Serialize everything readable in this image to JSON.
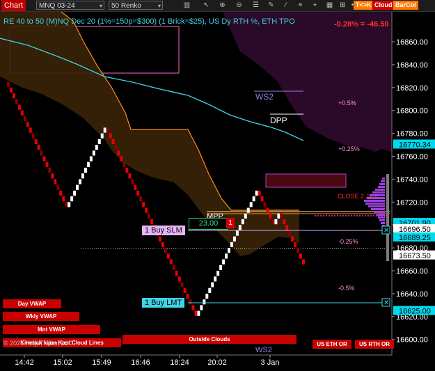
{
  "toolbar": {
    "title": "Chart",
    "instrument": "MNQ 03-24",
    "bar_type": "50 Renko",
    "buttons": [
      {
        "label": "T<>K",
        "color": "#ff7a00"
      },
      {
        "label": "Cloud",
        "color": "#d40000"
      },
      {
        "label": "BarCol",
        "color": "#ff7a00"
      }
    ],
    "icons": [
      "bars-icon",
      "cursor-icon",
      "zoom-in-icon",
      "zoom-out-icon",
      "properties-icon",
      "pen-icon",
      "draw-icon",
      "list-icon",
      "pin-icon",
      "grid-icon",
      "ruler-icon",
      "dot-icon"
    ]
  },
  "series_label": "RE 40 to 50 (M)NQ Dec 20 (1%=150p=$300) (1 Brick=$25), US Dy RTH %, ETH TPO",
  "pnl_label": "-0.28% = -46.50",
  "price_axis": {
    "ticks": [
      "16860.00",
      "16840.00",
      "16820.00",
      "16800.00",
      "16780.00",
      "16760.00",
      "16740.00",
      "16720.00",
      "16700.00",
      "16680.00",
      "16660.00",
      "16640.00",
      "16620.00",
      "16600.00"
    ],
    "markers": [
      {
        "label": "16770.34",
        "bg": "#00d9f0",
        "fg": "#000"
      },
      {
        "label": "16701.90",
        "bg": "#00d9f0",
        "fg": "#000"
      },
      {
        "label": "16696.50",
        "bg": "#fff",
        "fg": "#000"
      },
      {
        "label": "16689.25",
        "bg": "#00d9f0",
        "fg": "#000"
      },
      {
        "label": "16673.50",
        "bg": "#fff",
        "fg": "#000"
      },
      {
        "label": "16625.00",
        "bg": "#00d9f0",
        "fg": "#000"
      }
    ]
  },
  "time_axis": [
    "14:42",
    "15:02",
    "15:49",
    "16:46",
    "18:24",
    "20:02",
    "3 Jan"
  ],
  "levels": {
    "ws2": "WS2",
    "dpp": "DPP",
    "mpp": "MPP",
    "ws2_bottom": "WS2",
    "pct_labels": [
      "+0.5%",
      "+0.25%",
      "-0.25%",
      "-0.5%"
    ],
    "close_label": "CLOSE 2 JAN"
  },
  "orders": {
    "slm_label": "1 Buy SLM",
    "lmt_label": "1 Buy LMT",
    "position_qty": "23.00",
    "position_count": "1"
  },
  "indicator_buttons": {
    "day_vwap": "Day VWAP",
    "wkly_vwap": "Wkly VWAP",
    "mnt_vwap": "Mnt VWAP",
    "kijun": "Kinetick kijun Kast Cloud Lines",
    "outside_clouds": "Outside Clouds",
    "us_eth_or": "US ETH OR",
    "us_rth_or": "US RTH OR"
  },
  "copyright": "© 2024 NinjaTrader, LLC",
  "chart_data": {
    "type": "renko",
    "brick_size": 5,
    "ylim": [
      16590,
      16870
    ],
    "x_tick_labels": [
      "14:42",
      "15:02",
      "15:49",
      "16:46",
      "18:24",
      "20:02",
      "3 Jan"
    ],
    "bricks": [
      {
        "o": 16825,
        "c": 16820
      },
      {
        "o": 16820,
        "c": 16815
      },
      {
        "o": 16815,
        "c": 16810
      },
      {
        "o": 16810,
        "c": 16805
      },
      {
        "o": 16805,
        "c": 16800
      },
      {
        "o": 16800,
        "c": 16795
      },
      {
        "o": 16795,
        "c": 16790
      },
      {
        "o": 16790,
        "c": 16785
      },
      {
        "o": 16785,
        "c": 16780
      },
      {
        "o": 16780,
        "c": 16775
      },
      {
        "o": 16775,
        "c": 16770
      },
      {
        "o": 16770,
        "c": 16765
      },
      {
        "o": 16765,
        "c": 16760
      },
      {
        "o": 16760,
        "c": 16755
      },
      {
        "o": 16755,
        "c": 16750
      },
      {
        "o": 16750,
        "c": 16745
      },
      {
        "o": 16745,
        "c": 16740
      },
      {
        "o": 16740,
        "c": 16735
      },
      {
        "o": 16735,
        "c": 16730
      },
      {
        "o": 16730,
        "c": 16725
      },
      {
        "o": 16725,
        "c": 16720
      },
      {
        "o": 16720,
        "c": 16715
      },
      {
        "o": 16715,
        "c": 16720
      },
      {
        "o": 16720,
        "c": 16725
      },
      {
        "o": 16725,
        "c": 16730
      },
      {
        "o": 16730,
        "c": 16735
      },
      {
        "o": 16735,
        "c": 16740
      },
      {
        "o": 16740,
        "c": 16745
      },
      {
        "o": 16745,
        "c": 16750
      },
      {
        "o": 16750,
        "c": 16755
      },
      {
        "o": 16755,
        "c": 16760
      },
      {
        "o": 16760,
        "c": 16765
      },
      {
        "o": 16765,
        "c": 16770
      },
      {
        "o": 16770,
        "c": 16775
      },
      {
        "o": 16775,
        "c": 16780
      },
      {
        "o": 16780,
        "c": 16785
      },
      {
        "o": 16785,
        "c": 16780
      },
      {
        "o": 16780,
        "c": 16775
      },
      {
        "o": 16775,
        "c": 16770
      },
      {
        "o": 16770,
        "c": 16765
      },
      {
        "o": 16765,
        "c": 16760
      },
      {
        "o": 16760,
        "c": 16755
      },
      {
        "o": 16755,
        "c": 16750
      },
      {
        "o": 16750,
        "c": 16745
      },
      {
        "o": 16745,
        "c": 16740
      },
      {
        "o": 16740,
        "c": 16735
      },
      {
        "o": 16735,
        "c": 16730
      },
      {
        "o": 16730,
        "c": 16725
      },
      {
        "o": 16725,
        "c": 16720
      },
      {
        "o": 16720,
        "c": 16715
      },
      {
        "o": 16715,
        "c": 16710
      },
      {
        "o": 16710,
        "c": 16705
      },
      {
        "o": 16705,
        "c": 16700
      },
      {
        "o": 16700,
        "c": 16695
      },
      {
        "o": 16695,
        "c": 16690
      },
      {
        "o": 16690,
        "c": 16685
      },
      {
        "o": 16685,
        "c": 16680
      },
      {
        "o": 16680,
        "c": 16675
      },
      {
        "o": 16675,
        "c": 16670
      },
      {
        "o": 16670,
        "c": 16665
      },
      {
        "o": 16665,
        "c": 16660
      },
      {
        "o": 16660,
        "c": 16655
      },
      {
        "o": 16655,
        "c": 16650
      },
      {
        "o": 16650,
        "c": 16645
      },
      {
        "o": 16645,
        "c": 16640
      },
      {
        "o": 16640,
        "c": 16635
      },
      {
        "o": 16635,
        "c": 16630
      },
      {
        "o": 16630,
        "c": 16625
      },
      {
        "o": 16625,
        "c": 16620
      },
      {
        "o": 16620,
        "c": 16625
      },
      {
        "o": 16625,
        "c": 16630
      },
      {
        "o": 16630,
        "c": 16635
      },
      {
        "o": 16635,
        "c": 16640
      },
      {
        "o": 16640,
        "c": 16645
      },
      {
        "o": 16645,
        "c": 16650
      },
      {
        "o": 16650,
        "c": 16655
      },
      {
        "o": 16655,
        "c": 16660
      },
      {
        "o": 16660,
        "c": 16665
      },
      {
        "o": 16665,
        "c": 16670
      },
      {
        "o": 16670,
        "c": 16675
      },
      {
        "o": 16675,
        "c": 16680
      },
      {
        "o": 16680,
        "c": 16685
      },
      {
        "o": 16685,
        "c": 16690
      },
      {
        "o": 16690,
        "c": 16695
      },
      {
        "o": 16695,
        "c": 16700
      },
      {
        "o": 16700,
        "c": 16705
      },
      {
        "o": 16705,
        "c": 16710
      },
      {
        "o": 16710,
        "c": 16715
      },
      {
        "o": 16715,
        "c": 16720
      },
      {
        "o": 16720,
        "c": 16725
      },
      {
        "o": 16725,
        "c": 16730
      },
      {
        "o": 16730,
        "c": 16725
      },
      {
        "o": 16725,
        "c": 16720
      },
      {
        "o": 16720,
        "c": 16715
      },
      {
        "o": 16715,
        "c": 16710
      },
      {
        "o": 16710,
        "c": 16705
      },
      {
        "o": 16705,
        "c": 16700
      },
      {
        "o": 16700,
        "c": 16705
      },
      {
        "o": 16705,
        "c": 16710
      },
      {
        "o": 16710,
        "c": 16705
      },
      {
        "o": 16705,
        "c": 16700
      },
      {
        "o": 16700,
        "c": 16695
      },
      {
        "o": 16695,
        "c": 16690
      },
      {
        "o": 16690,
        "c": 16685
      },
      {
        "o": 16685,
        "c": 16680
      },
      {
        "o": 16680,
        "c": 16675
      },
      {
        "o": 16675,
        "c": 16670
      },
      {
        "o": 16670,
        "c": 16665
      }
    ],
    "levels": [
      {
        "name": "WS2",
        "price": 16815
      },
      {
        "name": "DPP",
        "price": 16795
      },
      {
        "name": "MPP",
        "price": 16702
      },
      {
        "name": "1 Buy SLM",
        "price": 16689.25
      },
      {
        "name": "1 Buy LMT",
        "price": 16625
      }
    ],
    "last_price": 16673.5,
    "grid": false
  },
  "colors": {
    "up_brick": "#ffffff",
    "down_brick": "#e60000",
    "dark_brick": "#8a0000",
    "cloud": "#3a2208",
    "cloud_edge": "#ff8c1a",
    "cyan": "#3fd3e6",
    "purple_zone": "#2a0a28",
    "axis_text": "#ffffff"
  }
}
